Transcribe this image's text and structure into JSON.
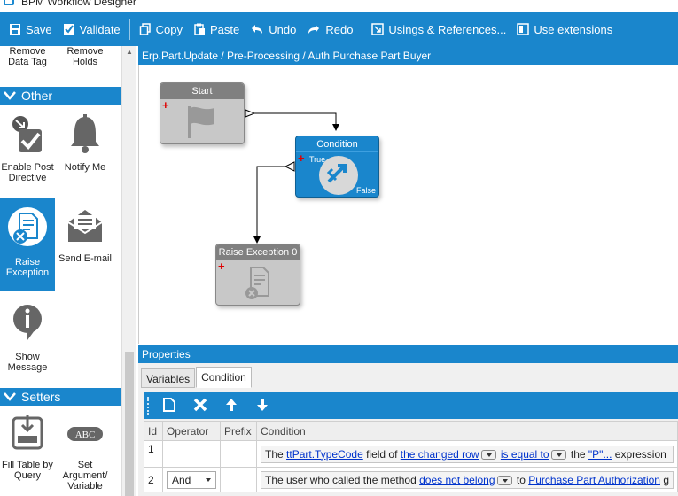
{
  "window": {
    "title": "BPM Workflow Designer"
  },
  "toolbar": {
    "save": "Save",
    "validate": "Validate",
    "copy": "Copy",
    "paste": "Paste",
    "undo": "Undo",
    "redo": "Redo",
    "usings": "Usings & References...",
    "extensions": "Use extensions"
  },
  "palette": {
    "top_items": [
      {
        "label": "Remove Data Tag"
      },
      {
        "label": "Remove Holds"
      }
    ],
    "groups": [
      {
        "title": "Other",
        "items": [
          {
            "label": "Enable Post Directive",
            "icon": "check-arrow-icon"
          },
          {
            "label": "Notify Me",
            "icon": "bell-icon"
          },
          {
            "label": "Raise Exception",
            "icon": "raise-exception-icon",
            "selected": true
          },
          {
            "label": "Send E-mail",
            "icon": "envelope-icon"
          },
          {
            "label": "Show Message",
            "icon": "info-bubble-icon"
          }
        ]
      },
      {
        "title": "Setters",
        "items": [
          {
            "label": "Fill Table by Query",
            "icon": "fill-table-icon"
          },
          {
            "label": "Set Argument/ Variable",
            "icon": "abc-icon"
          }
        ]
      }
    ]
  },
  "canvas": {
    "breadcrumb": "Erp.Part.Update / Pre-Processing / Auth Purchase Part Buyer",
    "nodes": {
      "start": {
        "label": "Start"
      },
      "condition": {
        "label": "Condition",
        "true_label": "True",
        "false_label": "False"
      },
      "raise": {
        "label": "Raise Exception 0"
      }
    }
  },
  "properties": {
    "title": "Properties",
    "tabs": [
      "Variables",
      "Condition"
    ],
    "active_tab": "Condition",
    "grid": {
      "columns": [
        "Id",
        "Operator",
        "Prefix",
        "Condition"
      ],
      "rows": [
        {
          "id": "1",
          "operator": "",
          "prefix": "",
          "condition": {
            "t1": "The ",
            "l1": "ttPart.TypeCode",
            "t2": " field of ",
            "l2": "the changed row",
            "l3": "is equal to",
            "t3": " the ",
            "l4": "\"P\"...",
            "t4": " expression"
          }
        },
        {
          "id": "2",
          "operator": "And",
          "prefix": "",
          "condition": {
            "t1": "The user who called the method ",
            "l1": "does not belong",
            "t2": " to ",
            "l2": " Purchase Part Authorization",
            "t3": " g"
          }
        }
      ]
    }
  },
  "colors": {
    "accent": "#1a86cc",
    "selected_bg": "#1a86cc",
    "link": "#0033cc",
    "plus": "#e00000"
  }
}
